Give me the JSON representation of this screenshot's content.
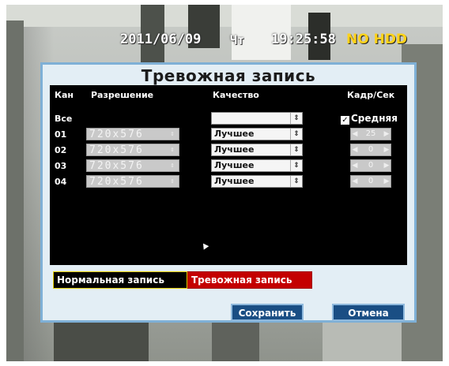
{
  "osd": {
    "date": "2011/06/09",
    "weekday": "Чт",
    "time": "19:25:58",
    "hdd_status": "NO HDD"
  },
  "dialog": {
    "title": "Тревожная запись",
    "headers": {
      "channel": "Кан",
      "resolution": "Разрешение",
      "quality": "Качество",
      "fps": "Кадр/Сек"
    },
    "all_row": {
      "label": "Все",
      "quality_value": "",
      "fps_checkbox_label": "Средняя",
      "fps_checked": true
    },
    "channels": [
      {
        "ch": "01",
        "resolution": "720x576",
        "quality": "Лучшее",
        "fps": "25"
      },
      {
        "ch": "02",
        "resolution": "720x576",
        "quality": "Лучшее",
        "fps": "0"
      },
      {
        "ch": "03",
        "resolution": "720x576",
        "quality": "Лучшее",
        "fps": "0"
      },
      {
        "ch": "04",
        "resolution": "720x576",
        "quality": "Лучшее",
        "fps": "0"
      }
    ],
    "tabs": {
      "normal": "Нормальная запись",
      "alarm": "Тревожная запись"
    },
    "buttons": {
      "save": "Сохранить",
      "cancel": "Отмена"
    }
  },
  "icons": {
    "spinner": "updown-spinner-icon",
    "arrow_left": "arrow-left-icon",
    "arrow_right": "arrow-right-icon",
    "checkbox": "checkbox-checked-icon",
    "cursor": "mouse-cursor-icon"
  },
  "colors": {
    "dialog_bg": "#e3eef5",
    "dialog_border": "#7fb0d6",
    "panel_bg": "#000000",
    "active_tab": "#c40000",
    "button_bg": "#1a4e84",
    "hdd_warning": "#ffd21a"
  }
}
